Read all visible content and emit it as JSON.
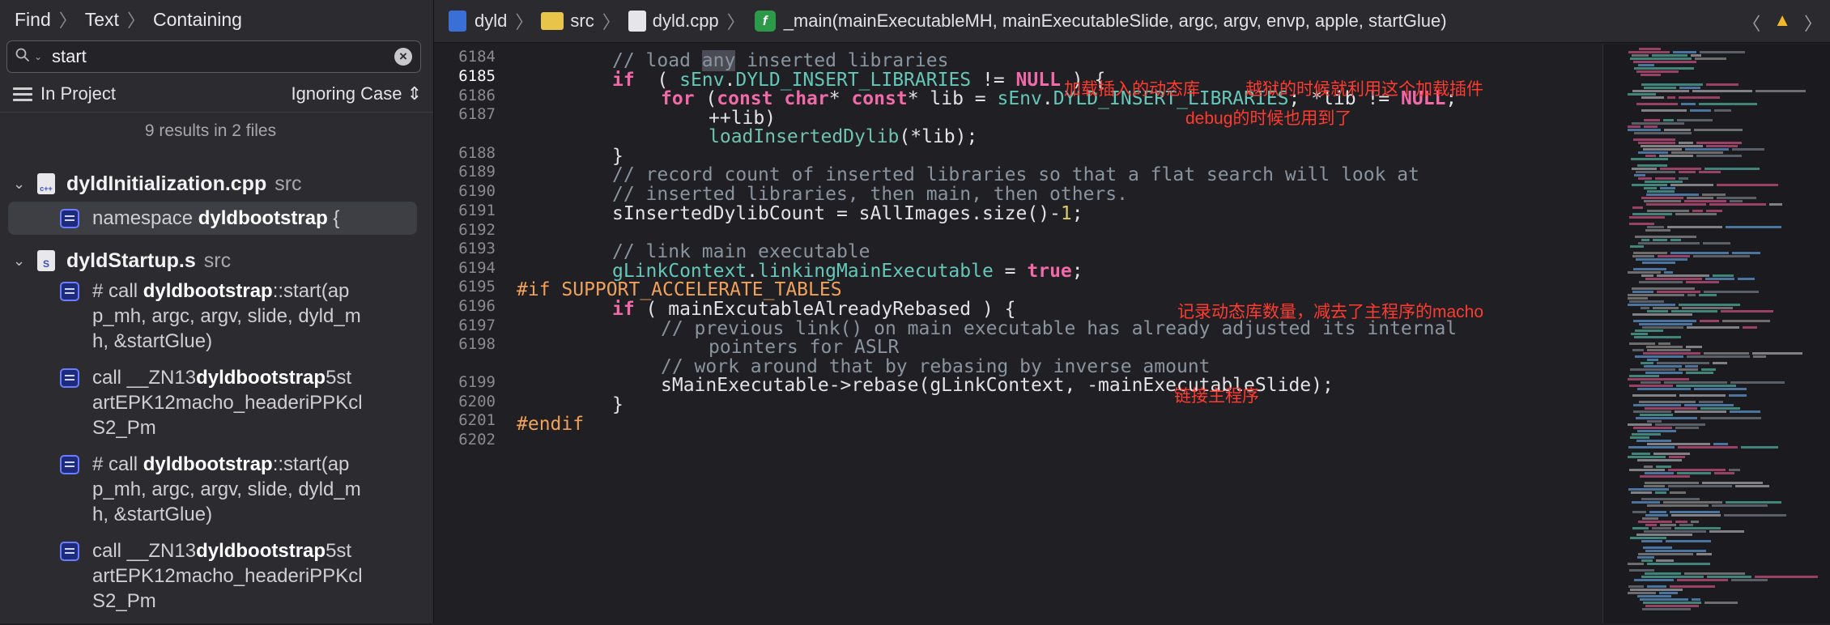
{
  "navigator": {
    "breadcrumb": [
      "Find",
      "Text",
      "Containing"
    ],
    "search": {
      "value": "start"
    },
    "scope": "In Project",
    "case_mode": "Ignoring Case",
    "summary": "9 results in 2 files",
    "files": [
      {
        "name": "dyldInitialization.cpp",
        "dir": "src",
        "results": [
          {
            "pre": "namespace ",
            "match": "dyldbootstrap",
            "post": " {",
            "selected": true
          }
        ]
      },
      {
        "name": "dyldStartup.s",
        "dir": "src",
        "results": [
          {
            "l1_pre": "# call ",
            "l1_match": "dyldbootstrap",
            "l1_post": "::start(ap",
            "l2": "p_mh, argc, argv, slide, dyld_m",
            "l3": "h, &startGlue)"
          },
          {
            "l1_pre": "call  __ZN13",
            "l1_match": "dyldbootstrap",
            "l1_post": "5st",
            "l2": "artEPK12macho_headeriPPKcl",
            "l3": "S2_Pm"
          },
          {
            "l1_pre": "# call ",
            "l1_match": "dyldbootstrap",
            "l1_post": "::start(ap",
            "l2": "p_mh, argc, argv, slide, dyld_m",
            "l3": "h, &startGlue)"
          },
          {
            "l1_pre": "call  __ZN13",
            "l1_match": "dyldbootstrap",
            "l1_post": "5st",
            "l2": "artEPK12macho_headeriPPKcl",
            "l3": "S2_Pm"
          }
        ]
      }
    ]
  },
  "jumpbar": {
    "project": "dyld",
    "folder": "src",
    "file": "dyld.cpp",
    "function": "_main(mainExecutableMH, mainExecutableSlide, argc, argv, envp, apple, startGlue)"
  },
  "gutter": {
    "l6184": "6184",
    "l6185": "6185",
    "l6186": "6186",
    "l6187": "6187",
    "l6188": "6188",
    "l6189": "6189",
    "l6190": "6190",
    "l6191": "6191",
    "l6192": "6192",
    "l6193": "6193",
    "l6194": "6194",
    "l6195": "6195",
    "l6196": "6196",
    "l6197": "6197",
    "l6198": "6198",
    "l6199": "6199",
    "l6200": "6200",
    "l6201": "6201",
    "l6202": "6202"
  },
  "code": {
    "l6185": {
      "a": "// load ",
      "b": "any",
      "c": " inserted libraries"
    },
    "l6186": {
      "a": "if",
      "b": "  ( ",
      "c": "sEnv",
      "d": ".",
      "e": "DYLD_INSERT_LIBRARIES",
      "f": " != ",
      "g": "NULL",
      "h": " ) {"
    },
    "l6187": {
      "a": "for",
      "b": " (",
      "c": "const",
      "d": " ",
      "e": "char",
      "f": "* ",
      "g": "const",
      "h": "* lib = ",
      "i": "sEnv",
      "j": ".",
      "k": "DYLD_INSERT_LIBRARIES",
      "l": "; *lib != ",
      "m": "NULL",
      "n": ";"
    },
    "l6187b": "++lib)",
    "l6188": {
      "a": "loadInsertedDylib",
      "b": "(*lib);"
    },
    "l6189": "}",
    "l6190": "// record count of inserted libraries so that a flat search will look at",
    "l6191": "// inserted libraries, then main, then others.",
    "l6192": {
      "a": "sInsertedDylibCount = sAllImages.size()-",
      "b": "1",
      "c": ";"
    },
    "l6194": "// link main executable",
    "l6195": {
      "a": "gLinkContext",
      "b": ".",
      "c": "linkingMainExecutable",
      "d": " = ",
      "e": "true",
      "f": ";"
    },
    "l6196": {
      "a": "#if ",
      "b": "SUPPORT_ACCELERATE_TABLES"
    },
    "l6197": {
      "a": "if",
      "b": " ( mainExcutableAlreadyRebased ) {"
    },
    "l6198": "// previous link() on main executable has already adjusted its internal",
    "l6198b": "pointers for ASLR",
    "l6199": "// work around that by rebasing by inverse amount",
    "l6200": "sMainExecutable->rebase(gLinkContext, -mainExecutableSlide);",
    "l6201": "}",
    "l6202": "#endif"
  },
  "annotations": {
    "a1": "加载插入的动态库",
    "a2": "越狱的时候就利用这个加载插件",
    "a3": "debug的时候也用到了",
    "a4": "记录动态库数量，减去了主程序的macho",
    "a5": "链接主程序"
  },
  "colors": {
    "annotation": "#ff3b30",
    "keyword": "#f06aa8",
    "comment": "#8a949e",
    "identifier": "#65c7b8",
    "number": "#dccb6a",
    "preprocessor": "#f0a25a"
  }
}
